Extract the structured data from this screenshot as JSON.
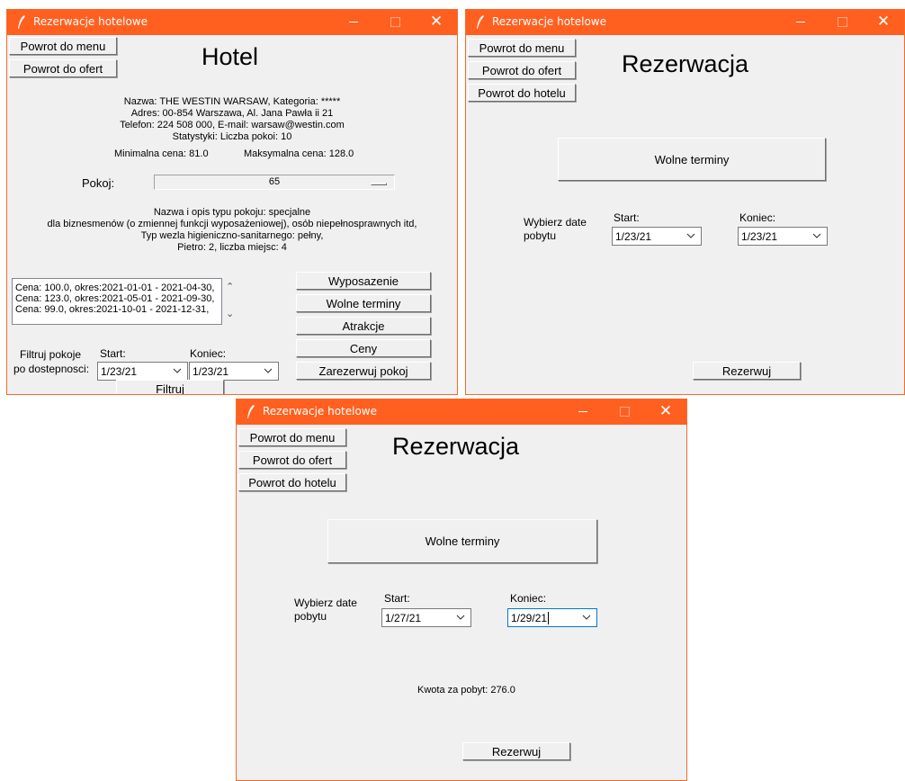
{
  "window_title": "Rezerwacje hotelowe",
  "colors": {
    "titlebar": "#ff6020",
    "window_bg": "#f0f0f0",
    "focus_border": "#0078d7"
  },
  "icons": {
    "app": "feather-icon",
    "minimize": "minimize-icon",
    "maximize": "maximize-icon",
    "close": "close-icon",
    "dropdown": "chevron-down-icon"
  },
  "hotel": {
    "btn_menu": "Powrot do menu",
    "btn_offers": "Powrot do ofert",
    "heading": "Hotel",
    "info_lines": [
      "Nazwa: THE WESTIN WARSAW, Kategoria: *****",
      "Adres: 00-854 Warszawa, Al. Jana Pawła ii 21",
      "Telefon: 224 508 000, E-mail: warsaw@westin.com",
      "Statystyki: Liczba pokoi: 10"
    ],
    "min_price": "Minimalna cena: 81.0",
    "max_price": "Maksymalna cena: 128.0",
    "room_label": "Pokoj:",
    "room_value": "65",
    "room_slider_fraction": 0.97,
    "room_lines": [
      "Nazwa i opis typu pokoju: specjalne",
      "dla biznesmenów (o zmiennej funkcji wyposażeniowej), osób niepełnosprawnych itd,",
      "Typ wezla higieniczno-sanitarnego: pełny,",
      "Pietro: 2, liczba miejsc: 4"
    ],
    "prices": [
      "Cena: 100.0, okres:2021-01-01 - 2021-04-30,",
      "Cena: 123.0, okres:2021-05-01 - 2021-09-30,",
      "Cena: 99.0, okres:2021-10-01 - 2021-12-31,"
    ],
    "btn_equipment": "Wyposazenie",
    "btn_free": "Wolne terminy",
    "btn_attractions": "Atrakcje",
    "btn_prices": "Ceny",
    "btn_book_room": "Zarezerwuj pokoj",
    "filter_label_1": "Filtruj pokoje",
    "filter_label_2": "po dostepnosci:",
    "start_label": "Start:",
    "end_label": "Koniec:",
    "start_value": "1/23/21",
    "end_value": "1/23/21",
    "btn_filter": "Filtruj"
  },
  "res1": {
    "btn_menu": "Powrot do menu",
    "btn_offers": "Powrot do ofert",
    "btn_hotel": "Powrot do hotelu",
    "heading": "Rezerwacja",
    "btn_free": "Wolne terminy",
    "choose_1": "Wybierz date",
    "choose_2": "pobytu",
    "start_label": "Start:",
    "end_label": "Koniec:",
    "start_value": "1/23/21",
    "end_value": "1/23/21",
    "btn_book": "Rezerwuj"
  },
  "res2": {
    "btn_menu": "Powrot do menu",
    "btn_offers": "Powrot do ofert",
    "btn_hotel": "Powrot do hotelu",
    "heading": "Rezerwacja",
    "btn_free": "Wolne terminy",
    "choose_1": "Wybierz date",
    "choose_2": "pobytu",
    "start_label": "Start:",
    "end_label": "Koniec:",
    "start_value": "1/27/21",
    "end_value": "1/29/21",
    "total": "Kwota za pobyt: 276.0",
    "btn_book": "Rezerwuj"
  }
}
